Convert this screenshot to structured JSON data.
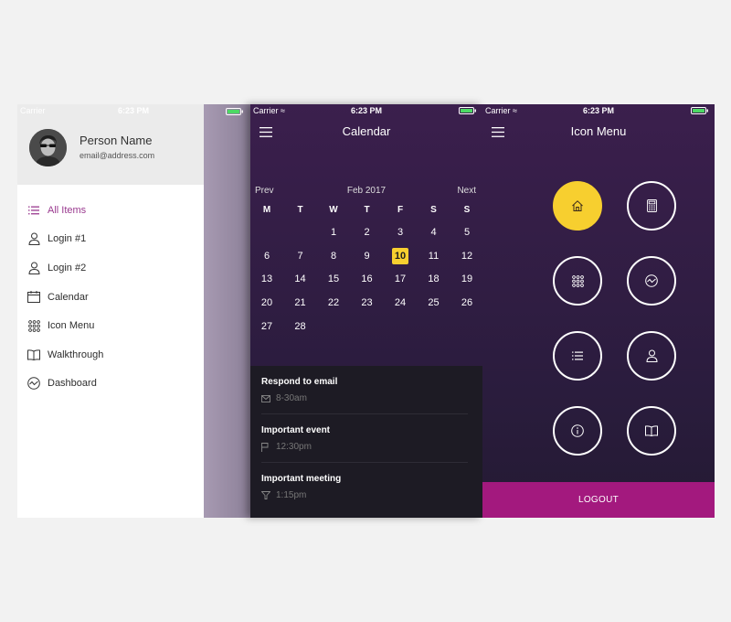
{
  "colors": {
    "accent_yellow": "#f7cf2f",
    "accent_purple": "#9a3a8f",
    "logout_magenta": "#a3197e",
    "dark_bg": "#2a1c3d",
    "events_bg": "#1d1b24",
    "battery_green": "#4cd964"
  },
  "side_menu": {
    "status": {
      "carrier": "Carrier",
      "time": "6:23 PM"
    },
    "profile": {
      "name": "Person Name",
      "email": "email@address.com"
    },
    "items": [
      {
        "label": "All Items",
        "icon": "list-icon",
        "active": true
      },
      {
        "label": "Login #1",
        "icon": "user-icon"
      },
      {
        "label": "Login #2",
        "icon": "user-icon"
      },
      {
        "label": "Calendar",
        "icon": "calendar-icon"
      },
      {
        "label": "Icon Menu",
        "icon": "grid-icon"
      },
      {
        "label": "Walkthrough",
        "icon": "book-icon"
      },
      {
        "label": "Dashboard",
        "icon": "chart-icon"
      }
    ]
  },
  "calendar": {
    "status": {
      "carrier": "Carrier",
      "time": "6:23 PM"
    },
    "title": "Calendar",
    "prev": "Prev",
    "month": "Feb 2017",
    "next": "Next",
    "weekdays": [
      "M",
      "T",
      "W",
      "T",
      "F",
      "S",
      "S"
    ],
    "weeks": [
      [
        "",
        "",
        "1",
        "2",
        "3",
        "4",
        "5"
      ],
      [
        "6",
        "7",
        "8",
        "9",
        "10",
        "11",
        "12"
      ],
      [
        "13",
        "14",
        "15",
        "16",
        "17",
        "18",
        "19"
      ],
      [
        "20",
        "21",
        "22",
        "23",
        "24",
        "25",
        "26"
      ],
      [
        "27",
        "28",
        "",
        "",
        "",
        "",
        ""
      ]
    ],
    "selected_day": "10",
    "events": [
      {
        "title": "Respond to email",
        "time": "8-30am",
        "icon": "mail-icon"
      },
      {
        "title": "Important event",
        "time": "12:30pm",
        "icon": "flag-icon"
      },
      {
        "title": "Important meeting",
        "time": "1:15pm",
        "icon": "filter-icon"
      }
    ]
  },
  "icon_menu": {
    "status": {
      "carrier": "Carrier",
      "time": "6:23 PM"
    },
    "title": "Icon Menu",
    "buttons": [
      {
        "icon": "home-icon",
        "active": true
      },
      {
        "icon": "calculator-icon"
      },
      {
        "icon": "grid-icon"
      },
      {
        "icon": "chart-icon"
      },
      {
        "icon": "list-icon"
      },
      {
        "icon": "user-icon"
      },
      {
        "icon": "info-icon"
      },
      {
        "icon": "book-icon"
      }
    ],
    "logout_label": "LOGOUT"
  }
}
